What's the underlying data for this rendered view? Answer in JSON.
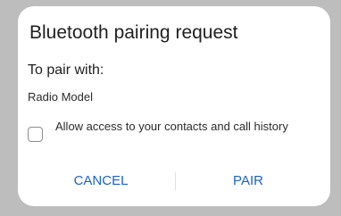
{
  "dialog": {
    "title": "Bluetooth pairing request",
    "subtitle": "To pair with:",
    "device_name": "Radio Model",
    "checkbox": {
      "label": "Allow access to your contacts and call history",
      "checked": false
    },
    "buttons": {
      "cancel_label": "CANCEL",
      "pair_label": "PAIR"
    }
  },
  "colors": {
    "accent": "#1b63c7",
    "backdrop": "#bdbdbd",
    "surface": "#ffffff"
  }
}
